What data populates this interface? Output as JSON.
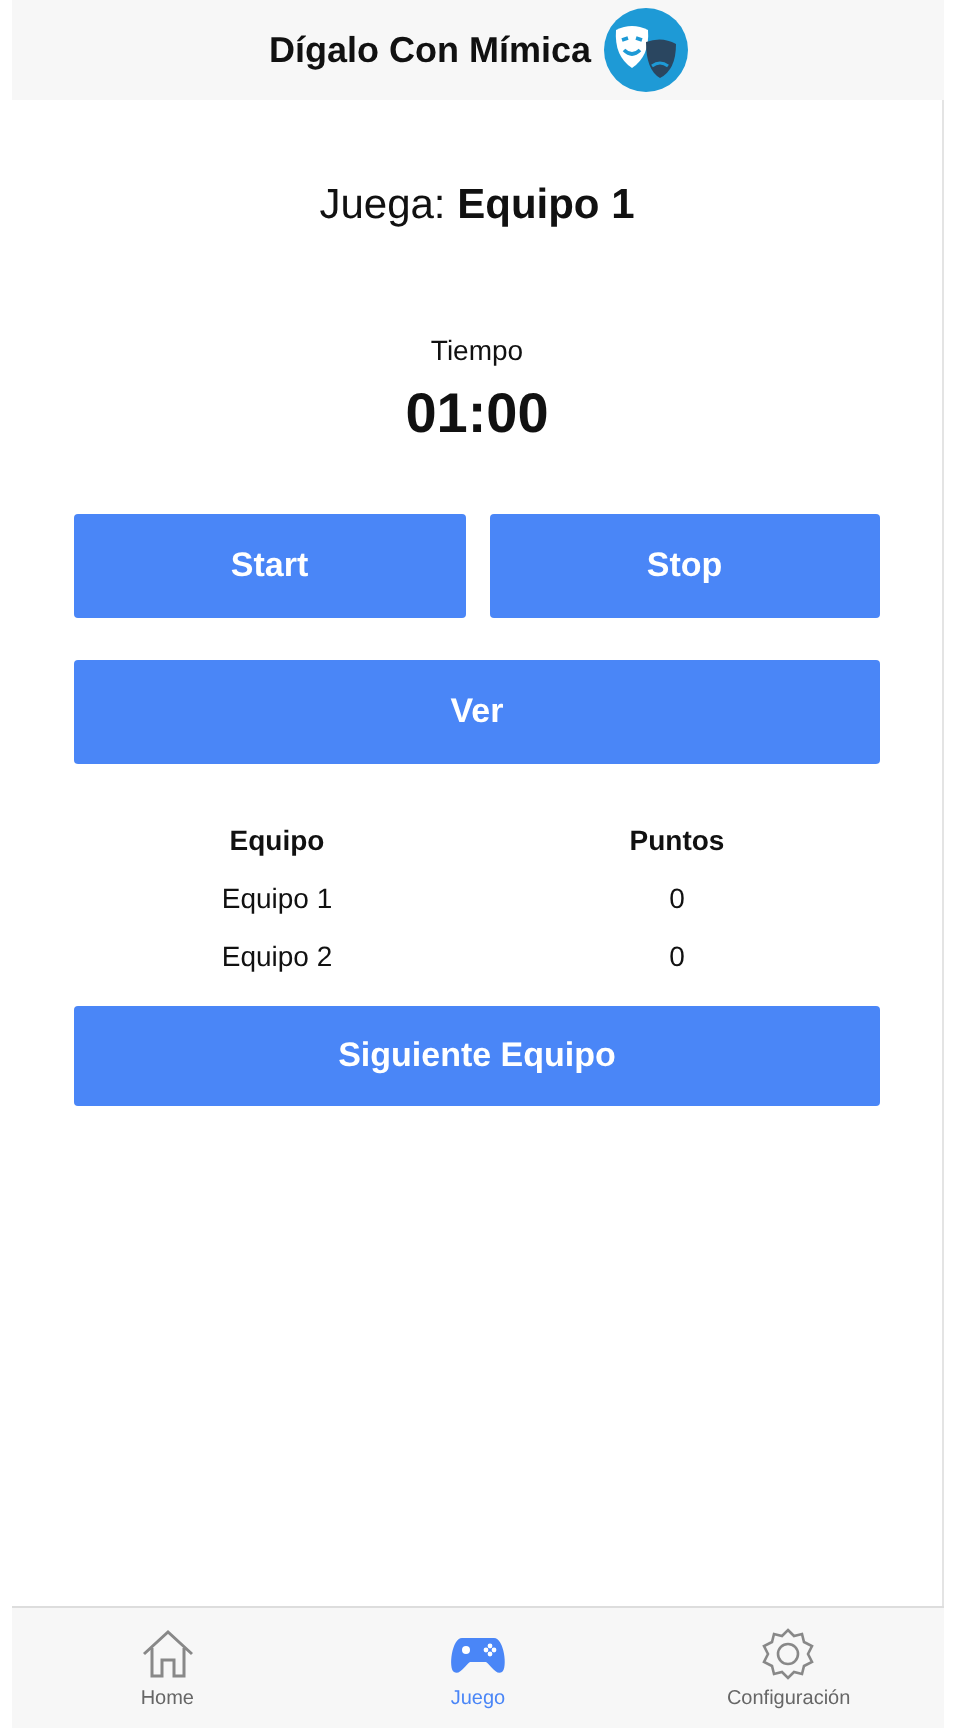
{
  "header": {
    "title": "Dígalo Con Mímica"
  },
  "turn": "Juega: **Equipo 1**",
  "timer": {
    "label": "Tiempo",
    "value": "01:00"
  },
  "buttons": [
    {
      "label": "Start"
    },
    {
      "label": "Stop"
    }
  ],
  "view_button": "Ver",
  "table": {
    "columns": [
      "Equipo",
      "Puntos"
    ],
    "rows": [
      [
        "Equipo 1",
        "0"
      ],
      [
        "Equipo 2",
        "0"
      ]
    ]
  },
  "next_button": "Siguiente Equipo",
  "tabs": [
    {
      "kind": "home",
      "label": "Home",
      "selected": false
    },
    {
      "kind": "game",
      "label": "Juego",
      "selected": true
    },
    {
      "kind": "settings",
      "label": "Configuración",
      "selected": false
    }
  ]
}
